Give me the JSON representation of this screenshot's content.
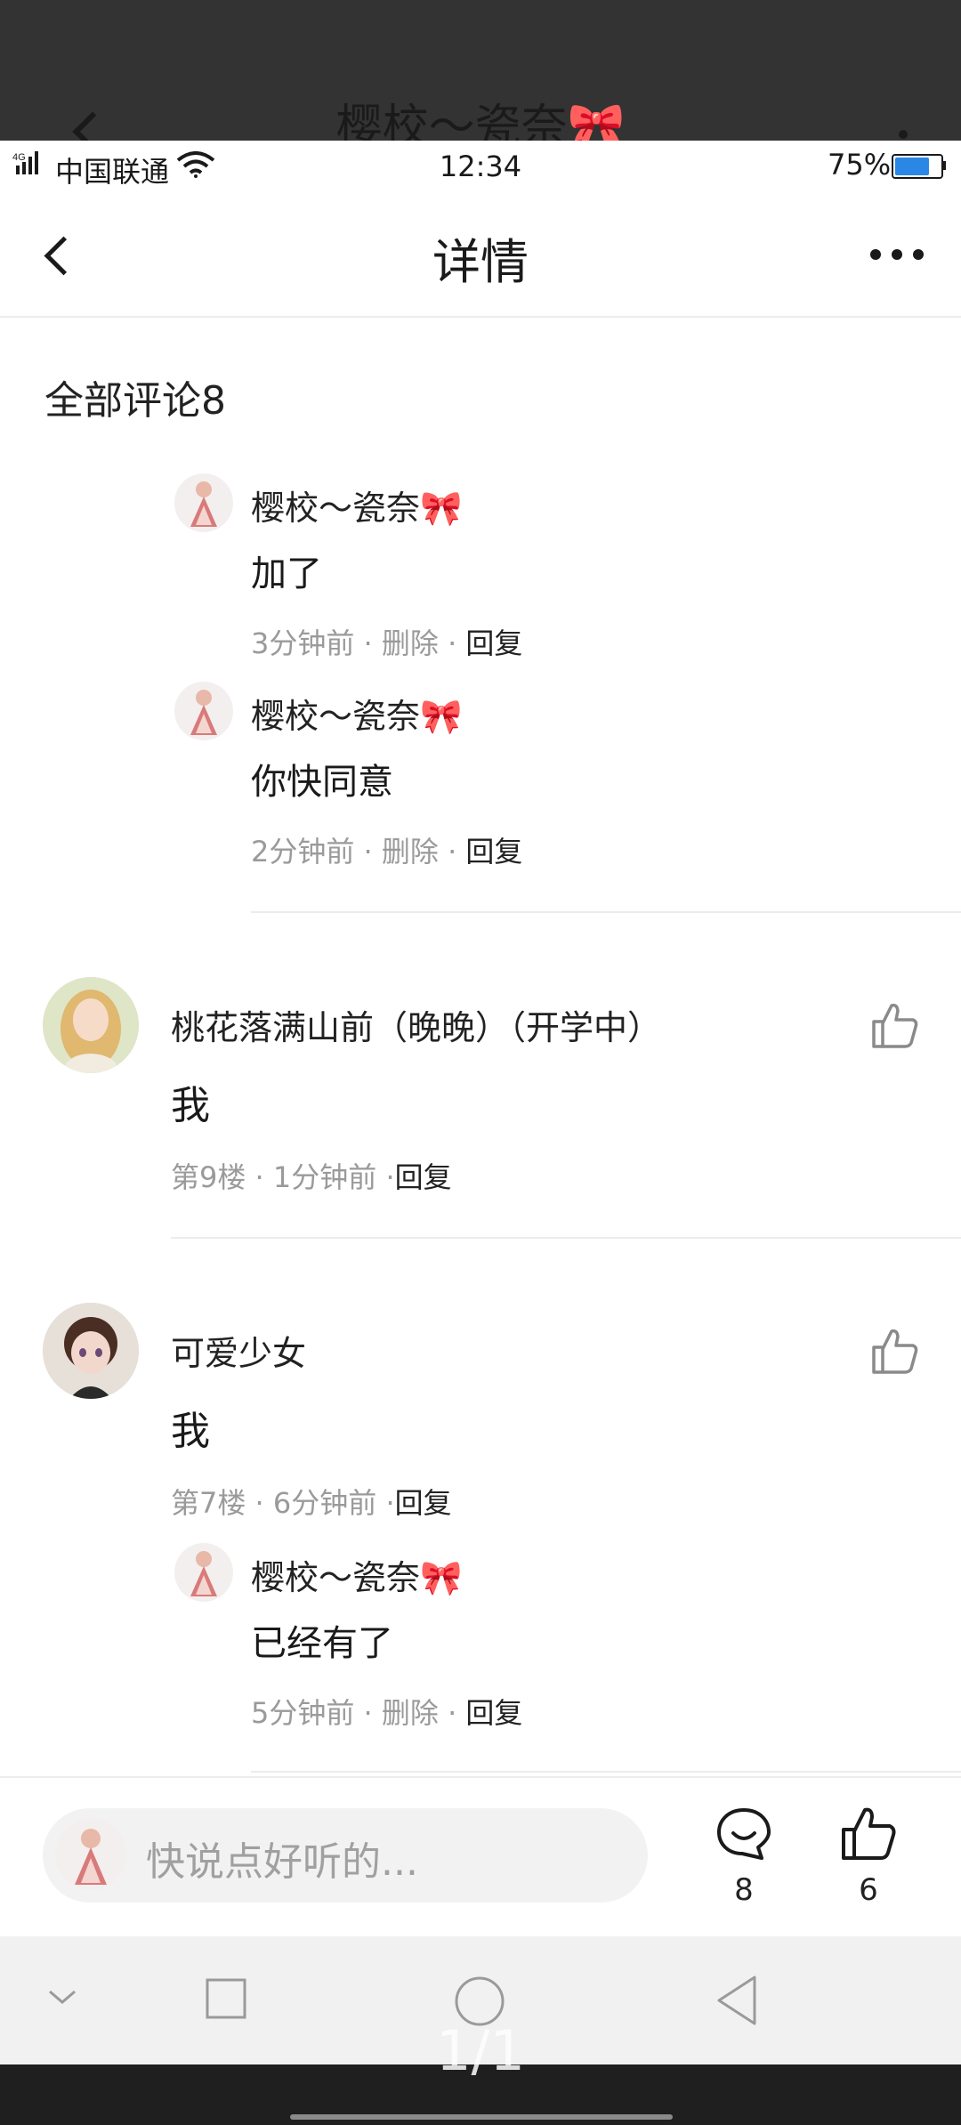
{
  "overlay": {
    "title": "樱校～瓷奈🎀"
  },
  "status_bar": {
    "network": "4G",
    "carrier": "中国联通",
    "time": "12:34",
    "battery": "75%",
    "battery_level": 0.75,
    "battery_color": "#2b87e6"
  },
  "header": {
    "back_icon": "chevron-left-icon",
    "title": "详情",
    "more_icon": "more-horizontal-icon"
  },
  "comments_heading": "全部评论8",
  "replies_top": [
    {
      "author": "樱校～瓷奈🎀",
      "text": "加了",
      "time": "3分钟前",
      "delete": "删除",
      "reply": "回复"
    },
    {
      "author": "樱校～瓷奈🎀",
      "text": "你快同意",
      "time": "2分钟前",
      "delete": "删除",
      "reply": "回复"
    }
  ],
  "comments": [
    {
      "author": "桃花落满山前（晚晚）（开学中）",
      "text": "我",
      "floor": "第9楼",
      "time": "1分钟前",
      "reply": "回复"
    },
    {
      "author": "可爱少女",
      "text": "我",
      "floor": "第7楼",
      "time": "6分钟前",
      "reply": "回复",
      "replies": [
        {
          "author": "樱校～瓷奈🎀",
          "text": "已经有了",
          "time": "5分钟前",
          "delete": "删除",
          "reply": "回复"
        }
      ]
    }
  ],
  "bottom_bar": {
    "placeholder": "快说点好听的...",
    "comment_count": "8",
    "like_count": "6"
  },
  "page_indicator": "1/1"
}
